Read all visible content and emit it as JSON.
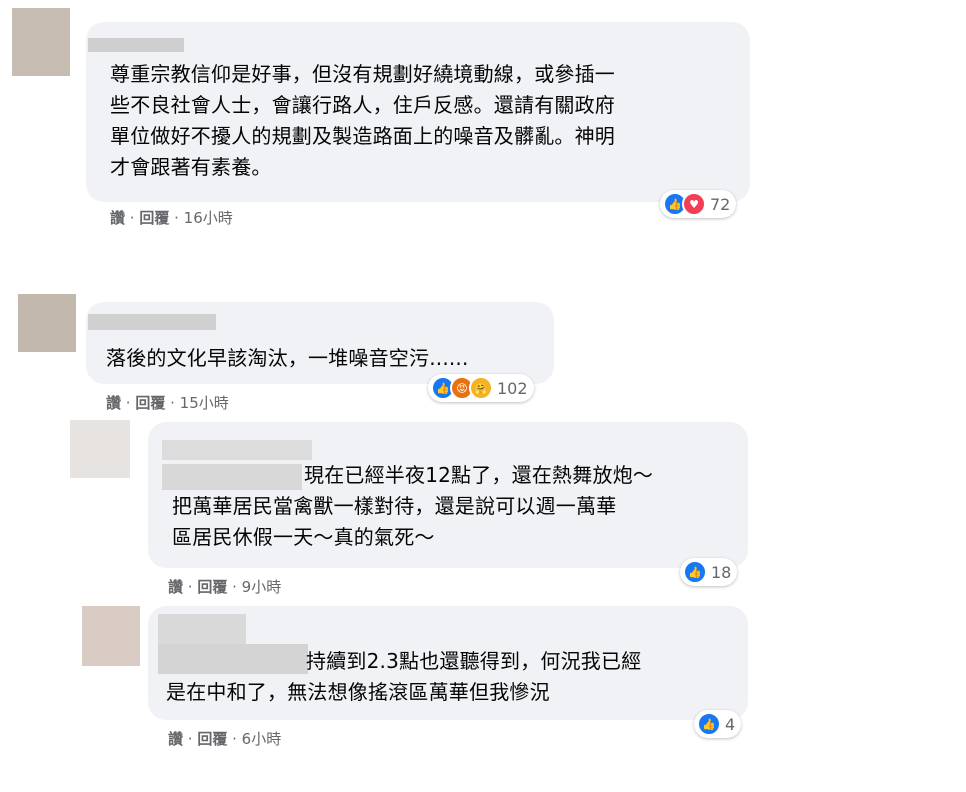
{
  "comments": [
    {
      "text": "尊重宗教信仰是好事，但沒有規劃好繞境動線，或參插一\n些不良社會人士，會讓行路人，住戶反感。還請有關政府\n單位做好不擾人的規劃及製造路面上的噪音及髒亂。神明\n才會跟著有素養。",
      "like": "讚",
      "reply": "回覆",
      "time": "16小時",
      "reaction_count": "72"
    },
    {
      "text": "落後的文化早該淘汰，一堆噪音空污......",
      "like": "讚",
      "reply": "回覆",
      "time": "15小時",
      "reaction_count": "102"
    },
    {
      "text": "現在已經半夜12點了，還在熱舞放炮～\n把萬華居民當禽獸一樣對待，還是說可以週一萬華\n區居民休假一天～真的氣死～",
      "like": "讚",
      "reply": "回覆",
      "time": "9小時",
      "reaction_count": "18"
    },
    {
      "text": "持續到2.3點也還聽得到，何況我已經\n是在中和了，無法想像搖滾區萬華但我慘況",
      "like": "讚",
      "reply": "回覆",
      "time": "6小時",
      "reaction_count": "4"
    }
  ],
  "separator": " · ",
  "colors": {
    "like": "#1877f2",
    "love": "#f33e58",
    "angry": "#e9710f",
    "care": "#f7b125"
  }
}
